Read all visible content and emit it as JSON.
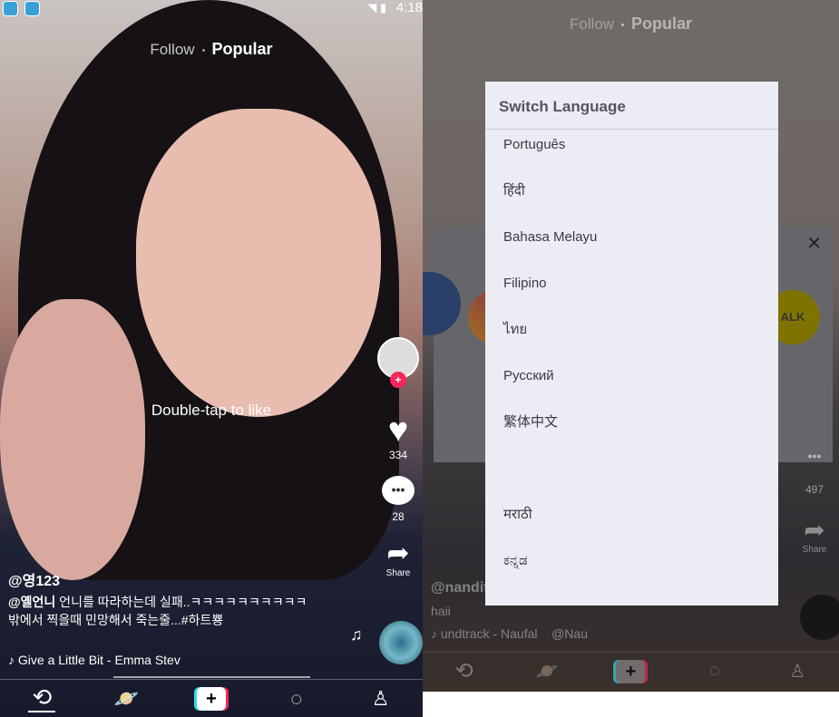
{
  "left": {
    "status": {
      "time": "4:18"
    },
    "top_nav": {
      "follow": "Follow",
      "popular": "Popular"
    },
    "overlay_hint": "Double-tap to like",
    "side": {
      "like_count": "334",
      "comment_count": "28",
      "share_label": "Share"
    },
    "caption": {
      "username": "@영123",
      "mention": "@옐언니",
      "text": " 언니를 따라하는데 실패..ㅋㅋㅋㅋㅋㅋㅋㅋㅋㅋ밖에서 찍을때 민망해서 죽는줄...#하트뿅",
      "music": "Give a Little Bit - Emma Stev"
    }
  },
  "right": {
    "top_nav": {
      "follow": "Follow",
      "popular": "Popular"
    },
    "side": {
      "comment_count": "497",
      "share_label": "Share"
    },
    "caption": {
      "username": "@nandita",
      "text": "haii",
      "music": "undtrack - Naufal",
      "music_author": "@Nau"
    },
    "share_icons": [
      "facebook",
      "instagram",
      "kakaotalk"
    ],
    "kakao_label": "ALK",
    "dialog": {
      "title": "Switch Language",
      "items": [
        "Português",
        "हिंदी",
        "Bahasa Melayu",
        "Filipino",
        "ไทย",
        "Русский",
        "繁体中文",
        "",
        "मराठी",
        "ಕನ್ನಡ"
      ]
    }
  },
  "colors": {
    "accent": "#f7265a",
    "cyan": "#29e0e8",
    "dialog_bg": "#ececf5"
  }
}
